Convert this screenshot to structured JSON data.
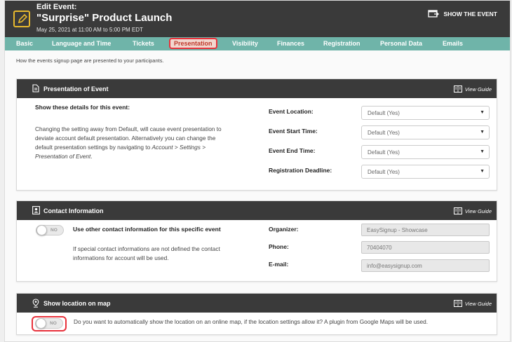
{
  "header": {
    "pre_title": "Edit Event:",
    "title": "\"Surprise\" Product Launch",
    "date": "May 25, 2021 at 11:00 AM to 5:00 PM EDT",
    "show_event": "SHOW THE EVENT"
  },
  "nav": {
    "tabs": [
      {
        "label": "Basic"
      },
      {
        "label": "Language and Time"
      },
      {
        "label": "Tickets"
      },
      {
        "label": "Presentation"
      },
      {
        "label": "Visibility"
      },
      {
        "label": "Finances"
      },
      {
        "label": "Registration"
      },
      {
        "label": "Personal Data"
      },
      {
        "label": "Emails"
      }
    ],
    "active": "Presentation"
  },
  "description": "How the events signup page are presented to your participants.",
  "view_guide": "View Guide",
  "presentation": {
    "title": "Presentation of Event",
    "subtitle": "Show these details for this event:",
    "para_1": "Changing the setting away from Default, will cause event presentation to",
    "para_2": "deviate account default presentation. Alternatively you can change the",
    "para_3a": "default presentation settings by navigating to ",
    "para_3b": "Account > Settings >",
    "para_4": "Presentation of Event",
    "para_4_end": ".",
    "fields": [
      {
        "label": "Event Location:",
        "value": "Default (Yes)"
      },
      {
        "label": "Event Start Time:",
        "value": "Default (Yes)"
      },
      {
        "label": "Event End Time:",
        "value": "Default (Yes)"
      },
      {
        "label": "Registration Deadline:",
        "value": "Default (Yes)"
      }
    ]
  },
  "contact": {
    "title": "Contact Information",
    "toggle": "NO",
    "toggle_label": "Use other contact information for this specific event",
    "note_1": "If special contact informations are not defined the contact",
    "note_2": "informations for account will be used.",
    "fields": [
      {
        "label": "Organizer:",
        "value": "EasySignup - Showcase"
      },
      {
        "label": "Phone:",
        "value": "70404070"
      },
      {
        "label": "E-mail:",
        "value": "info@easysignup.com"
      }
    ]
  },
  "map": {
    "title": "Show location on map",
    "toggle": "NO",
    "question": "Do you want to automatically show the location on an online map, if the location settings allow it? A plugin from Google Maps will be used."
  },
  "colors": {
    "header_bg": "#3a3a3a",
    "nav_bg": "#6fb4a9",
    "highlight": "#e8323c",
    "edit_icon": "#e8b92e"
  }
}
